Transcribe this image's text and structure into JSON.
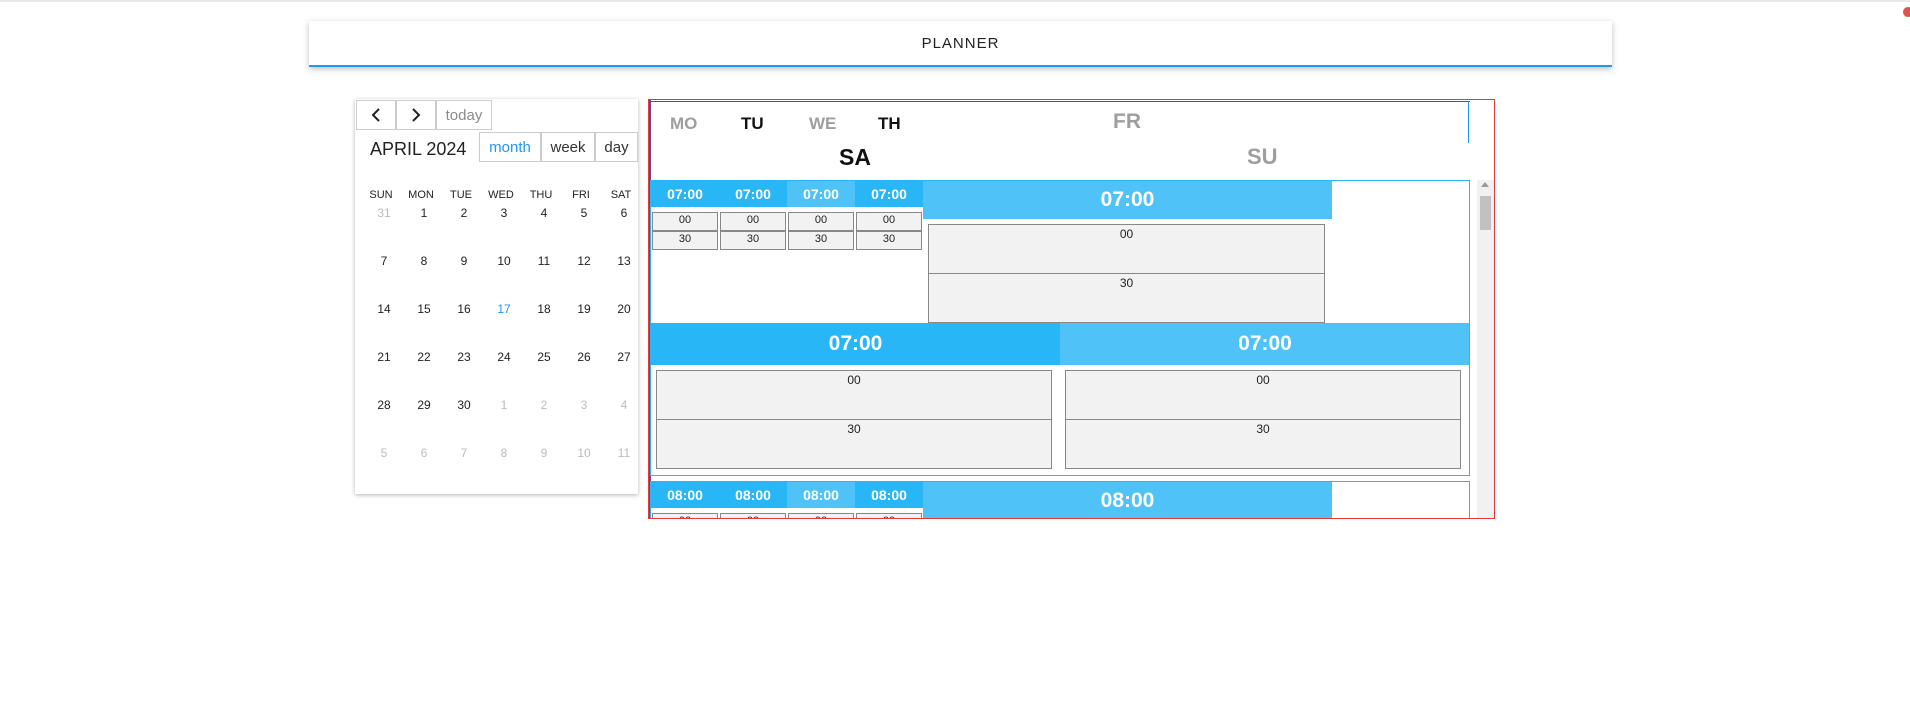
{
  "app": {
    "title": "PLANNER"
  },
  "mini_calendar": {
    "prev_icon": "chevron-left-icon",
    "next_icon": "chevron-right-icon",
    "today_label": "today",
    "month_title": "APRIL 2024",
    "views": [
      "month",
      "week",
      "day"
    ],
    "active_view": "month",
    "weekdays": [
      "SUN",
      "MON",
      "TUE",
      "WED",
      "THU",
      "FRI",
      "SAT"
    ],
    "weeks": [
      [
        "31",
        "1",
        "2",
        "3",
        "4",
        "5",
        "6"
      ],
      [
        "7",
        "8",
        "9",
        "10",
        "11",
        "12",
        "13"
      ],
      [
        "14",
        "15",
        "16",
        "17",
        "18",
        "19",
        "20"
      ],
      [
        "21",
        "22",
        "23",
        "24",
        "25",
        "26",
        "27"
      ],
      [
        "28",
        "29",
        "30",
        "1",
        "2",
        "3",
        "4"
      ],
      [
        "5",
        "6",
        "7",
        "8",
        "9",
        "10",
        "11"
      ]
    ],
    "today_date": "17"
  },
  "planner": {
    "day_headers": {
      "mo": "MO",
      "tu": "TU",
      "we": "WE",
      "th": "TH",
      "fr": "FR",
      "sa": "SA",
      "su": "SU"
    },
    "hour_7": "07:00",
    "hour_8": "08:00",
    "slot_00": "00",
    "slot_30": "30"
  },
  "colors": {
    "accent": "#2196f3",
    "light_blue": "#4fc3f7",
    "mid_blue": "#29b6f6",
    "border_red": "#e53935"
  }
}
